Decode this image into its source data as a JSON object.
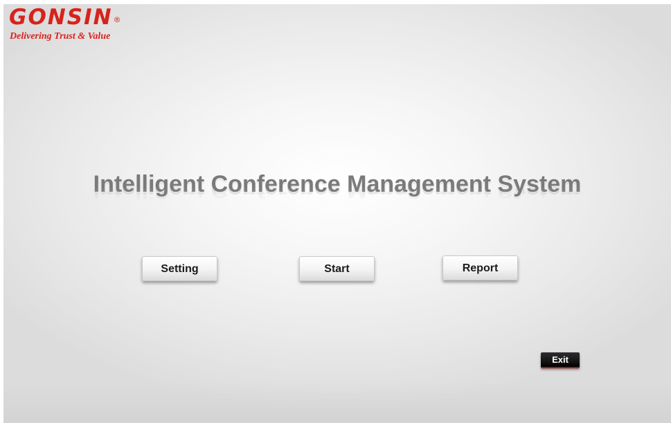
{
  "brand": {
    "name": "GONSIN",
    "registered_mark": "®",
    "tagline": "Delivering Trust & Value",
    "color": "#d8221c"
  },
  "main": {
    "title": "Intelligent Conference Management System"
  },
  "buttons": {
    "setting_label": "Setting",
    "start_label": "Start",
    "report_label": "Report",
    "exit_label": "Exit"
  }
}
